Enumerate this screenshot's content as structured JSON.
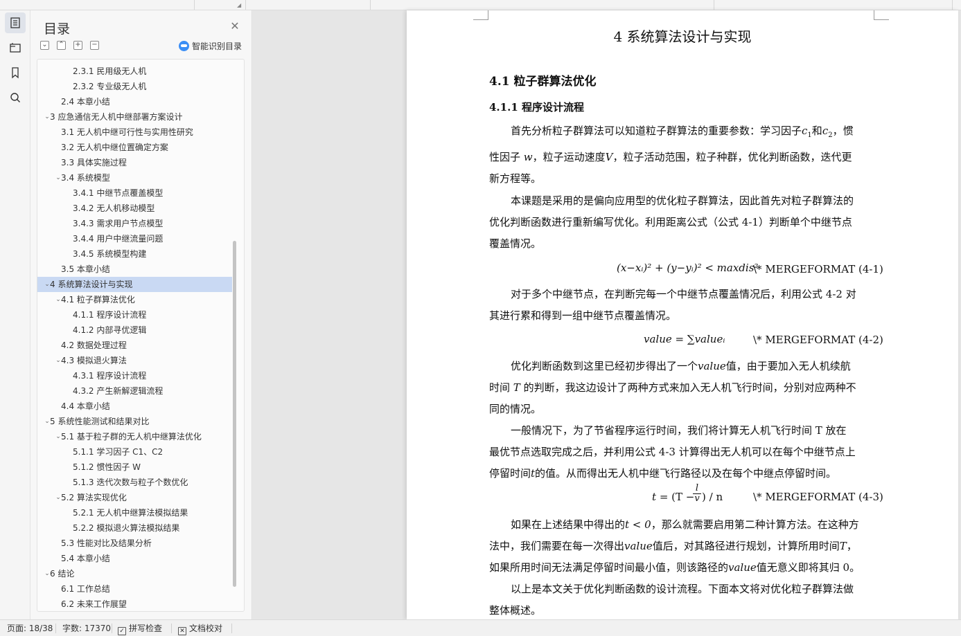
{
  "toc_panel": {
    "title": "目录",
    "close_icon": "close-icon",
    "ai_toc_label": "智能识别目录",
    "tool_icons": [
      "collapse-all-icon",
      "expand-up-icon",
      "add-heading-icon",
      "remove-heading-icon"
    ],
    "items": [
      {
        "label": "2.3.1 民用级无人机",
        "level": 3,
        "caret": ""
      },
      {
        "label": "2.3.2 专业级无人机",
        "level": 3,
        "caret": ""
      },
      {
        "label": "2.4 本章小结",
        "level": 2,
        "caret": ""
      },
      {
        "label": "3 应急通信无人机中继部署方案设计",
        "level": 1,
        "caret": "⌄"
      },
      {
        "label": "3.1 无人机中继可行性与实用性研究",
        "level": 2,
        "caret": ""
      },
      {
        "label": "3.2 无人机中继位置确定方案",
        "level": 2,
        "caret": ""
      },
      {
        "label": "3.3 具体实施过程",
        "level": 2,
        "caret": ""
      },
      {
        "label": "3.4 系统模型",
        "level": 2,
        "caret": "⌄"
      },
      {
        "label": "3.4.1  中继节点覆盖模型",
        "level": 3,
        "caret": ""
      },
      {
        "label": "3.4.2 无人机移动模型",
        "level": 3,
        "caret": ""
      },
      {
        "label": "3.4.3 需求用户节点模型",
        "level": 3,
        "caret": ""
      },
      {
        "label": "3.4.4  用户中继流量问题",
        "level": 3,
        "caret": ""
      },
      {
        "label": "3.4.5  系统模型构建",
        "level": 3,
        "caret": ""
      },
      {
        "label": "3.5 本章小结",
        "level": 2,
        "caret": ""
      },
      {
        "label": "4 系统算法设计与实现",
        "level": 1,
        "caret": "⌄",
        "selected": true
      },
      {
        "label": "4.1 粒子群算法优化",
        "level": 2,
        "caret": "⌄"
      },
      {
        "label": "4.1.1 程序设计流程",
        "level": 3,
        "caret": ""
      },
      {
        "label": "4.1.2    内部寻优逻辑",
        "level": 3,
        "caret": ""
      },
      {
        "label": "4.2 数据处理过程",
        "level": 2,
        "caret": ""
      },
      {
        "label": "4.3 模拟退火算法",
        "level": 2,
        "caret": "⌄"
      },
      {
        "label": "4.3.1 程序设计流程",
        "level": 3,
        "caret": ""
      },
      {
        "label": "4.3.2 产生新解逻辑流程",
        "level": 3,
        "caret": ""
      },
      {
        "label": "4.4 本章小结",
        "level": 2,
        "caret": ""
      },
      {
        "label": "5 系统性能测试和结果对比",
        "level": 1,
        "caret": "⌄"
      },
      {
        "label": "5.1 基于粒子群的无人机中继算法优化",
        "level": 2,
        "caret": "⌄"
      },
      {
        "label": "5.1.1 学习因子 C1、C2",
        "level": 3,
        "caret": ""
      },
      {
        "label": "5.1.2 惯性因子 W",
        "level": 3,
        "caret": ""
      },
      {
        "label": "5.1.3 迭代次数与粒子个数优化",
        "level": 3,
        "caret": ""
      },
      {
        "label": "5.2 算法实现优化",
        "level": 2,
        "caret": "⌄"
      },
      {
        "label": "5.2.1 无人机中继算法模拟结果",
        "level": 3,
        "caret": ""
      },
      {
        "label": "5.2.2 模拟退火算法模拟结果",
        "level": 3,
        "caret": ""
      },
      {
        "label": "5.3 性能对比及结果分析",
        "level": 2,
        "caret": ""
      },
      {
        "label": "5.4 本章小结",
        "level": 2,
        "caret": ""
      },
      {
        "label": "6 结论",
        "level": 1,
        "caret": "⌄"
      },
      {
        "label": "6.1 工作总结",
        "level": 2,
        "caret": ""
      },
      {
        "label": "6.2 未来工作展望",
        "level": 2,
        "caret": ""
      }
    ]
  },
  "rail": {
    "icons": [
      "toc-icon",
      "outline-icon",
      "bookmark-icon",
      "search-icon"
    ]
  },
  "document": {
    "chapter_title": "4 系统算法设计与实现",
    "section_title": "4.1 粒子群算法优化",
    "subsection_title": "4.1.1 程序设计流程",
    "p1": {
      "l1": "首先分析粒子群算法可以知道粒子群算法的重要参数：学习因子",
      "c1": "c",
      "sub1": "1",
      "and": "和",
      "c2": "c",
      "sub2": "2",
      "tail": "，惯",
      "l2a": "性因子",
      "w": "w",
      "l2b": "，粒子运动速度",
      "v": "V",
      "l2c": "，粒子活动范围，粒子种群，优化判断函数，迭代更",
      "l3": "新方程等。"
    },
    "p2": {
      "l1": "本课题是采用的是偏向应用型的优化粒子群算法，因此首先对粒子群算法的",
      "l2": "优化判断函数进行重新编写优化。利用距离公式（公式 4-1）判断单个中继节点",
      "l3": "覆盖情况。"
    },
    "eq1": {
      "formula": "(x−xᵢ)² + (y−yᵢ)² < maxdis²",
      "tag": "\\* MERGEFORMAT (4-1)"
    },
    "p3": {
      "l1": "对于多个中继节点，在判断完每一个中继节点覆盖情况后，利用公式 4-2 对",
      "l2": "其进行累和得到一组中继节点覆盖情况。"
    },
    "eq2": {
      "formula": "value = ∑valueᵢ",
      "tag": "\\* MERGEFORMAT (4-2)"
    },
    "p4": {
      "l1a": "优化判断函数到这里已经初步得出了一个",
      "value": "value",
      "l1b": "值，由于要加入无人机续航",
      "l2a": "时间",
      "T": "T",
      "l2b": "的判断，我这边设计了两种方式来加入无人机飞行时间，分别对应两种不",
      "l3": "同的情况。"
    },
    "p5": {
      "l1": "一般情况下，为了节省程序运行时间，我们将计算无人机飞行时间 T 放在",
      "l2": "最优节点选取完成之后，并利用公式 4-3 计算得出无人机可以在每个中继节点上",
      "l3a": "停留时间",
      "t": "t",
      "l3b": "的值。从而得出无人机中继飞行路径以及在每个中继点停留时间。"
    },
    "eq3": {
      "t": "t",
      "eq": "= (T −",
      "num": "l",
      "den": "v",
      "tail": ") / n",
      "tag": "\\* MERGEFORMAT (4-3)"
    },
    "p6": {
      "l1a": "如果在上述结果中得出的",
      "cond": "t < 0",
      "l1b": "，那么就需要启用第二种计算方法。在这种方",
      "l2a": "法中，我们需要在每一次得出",
      "value": "value",
      "l2b": "值后，对其路径进行规划，计算所用时间",
      "T": "T",
      "l2c": "，",
      "l3a": "如果所用时间无法满足停留时间最小值，则该路径的",
      "value2": "value",
      "l3b": "值无意义即将其归 0。"
    },
    "p7": {
      "l1": "以上是本文关于优化判断函数的设计流程。下面本文将对优化粒子群算法做",
      "l2": "整体概述。"
    }
  },
  "statusbar": {
    "page": "页面: 18/38",
    "words": "字数: 17370",
    "spell_check": "拼写检查",
    "doc_proof": "文档校对"
  }
}
